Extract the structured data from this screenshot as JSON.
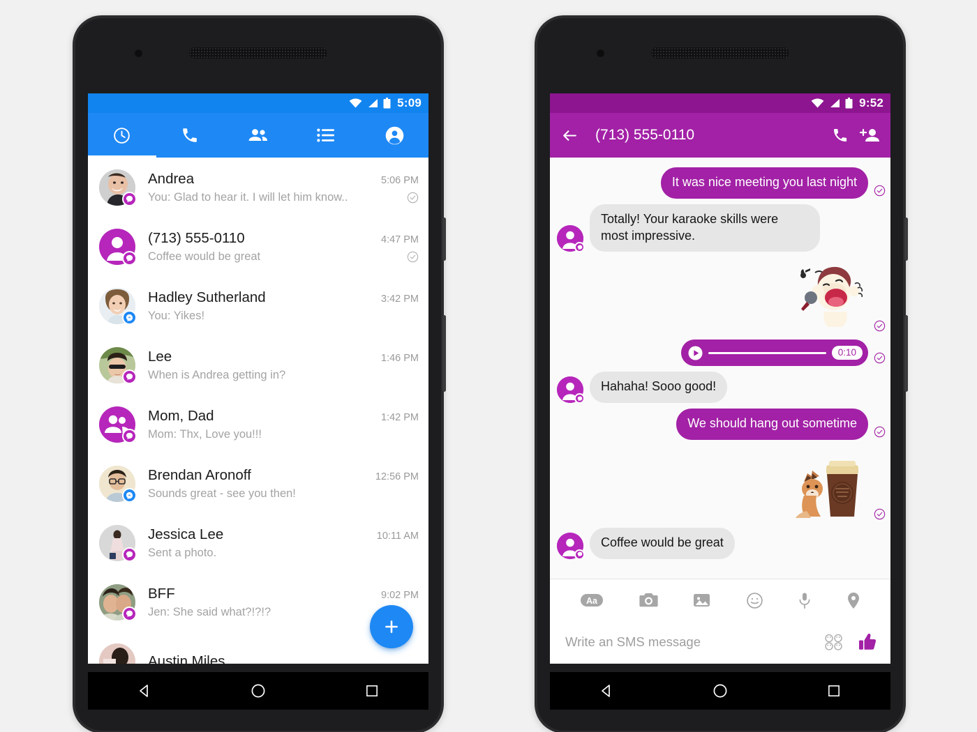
{
  "left_phone": {
    "status_bar": {
      "time": "5:09",
      "wifi_icon": "wifi-icon",
      "signal_icon": "signal-icon",
      "battery_icon": "battery-icon"
    },
    "accent_color": "#1e88f5",
    "tabs": [
      {
        "name": "recents-tab",
        "icon": "clock-icon",
        "active": true
      },
      {
        "name": "calls-tab",
        "icon": "phone-icon",
        "active": false
      },
      {
        "name": "people-tab",
        "icon": "people-icon",
        "active": false
      },
      {
        "name": "groups-tab",
        "icon": "list-icon",
        "active": false
      },
      {
        "name": "profile-tab",
        "icon": "account-icon",
        "active": false
      }
    ],
    "conversations": [
      {
        "name": "Andrea",
        "snippet": "You: Glad to hear it. I will let him know..",
        "time": "5:06 PM",
        "badge": "sms",
        "delivered": true,
        "avatar": "photo-man-laughing"
      },
      {
        "name": "(713) 555-0110",
        "snippet": "Coffee would be great",
        "time": "4:47 PM",
        "badge": "sms",
        "delivered": true,
        "avatar": "placeholder-person"
      },
      {
        "name": "Hadley Sutherland",
        "snippet": "You: Yikes!",
        "time": "3:42 PM",
        "badge": "messenger",
        "delivered": false,
        "avatar": "photo-woman-blonde"
      },
      {
        "name": "Lee",
        "snippet": "When is Andrea getting in?",
        "time": "1:46 PM",
        "badge": "sms",
        "delivered": false,
        "avatar": "photo-woman-sunglasses"
      },
      {
        "name": "Mom, Dad",
        "snippet": "Mom: Thx, Love you!!!",
        "time": "1:42 PM",
        "badge": "sms",
        "delivered": false,
        "avatar": "placeholder-group"
      },
      {
        "name": "Brendan Aronoff",
        "snippet": "Sounds great - see you then!",
        "time": "12:56 PM",
        "badge": "messenger",
        "delivered": false,
        "avatar": "photo-man-glasses"
      },
      {
        "name": "Jessica Lee",
        "snippet": "Sent a photo.",
        "time": "10:11 AM",
        "badge": "sms",
        "delivered": false,
        "avatar": "photo-woman-standing"
      },
      {
        "name": "BFF",
        "snippet": "Jen: She said what?!?!?",
        "time": "9:02 PM",
        "badge": "sms",
        "delivered": false,
        "avatar": "photo-two-women"
      },
      {
        "name": "Austin Miles",
        "snippet": "",
        "time": "",
        "badge": "sms",
        "delivered": false,
        "avatar": "photo-person-partial"
      }
    ],
    "fab": {
      "label": "+",
      "name": "new-conversation-fab"
    },
    "nav_bar": {
      "back": "back-icon",
      "home": "home-icon",
      "recents": "recents-icon"
    }
  },
  "right_phone": {
    "status_bar": {
      "time": "9:52",
      "wifi_icon": "wifi-icon",
      "signal_icon": "signal-icon",
      "battery_icon": "battery-icon"
    },
    "accent_color": "#a221a6",
    "header": {
      "back_icon": "arrow-back-icon",
      "title": "(713) 555-0110",
      "call_icon": "phone-icon",
      "add_person_icon": "person-add-icon"
    },
    "messages": [
      {
        "type": "text",
        "direction": "out",
        "text": "It was nice meeting you last night",
        "delivered": true
      },
      {
        "type": "text",
        "direction": "in",
        "text": "Totally! Your karaoke skills were most impressive.",
        "delivered": false
      },
      {
        "type": "sticker",
        "direction": "out",
        "sticker": "karaoke-singer-sticker",
        "delivered": true
      },
      {
        "type": "audio",
        "direction": "out",
        "duration": "0:10",
        "play_icon": "play-icon",
        "delivered": true
      },
      {
        "type": "text",
        "direction": "in",
        "text": "Hahaha! Sooo good!",
        "delivered": false
      },
      {
        "type": "text",
        "direction": "out",
        "text": "We should hang out sometime",
        "delivered": true
      },
      {
        "type": "sticker",
        "direction": "out",
        "sticker": "fox-coffee-cup-sticker",
        "delivered": true
      },
      {
        "type": "text",
        "direction": "in",
        "text": "Coffee would be great",
        "delivered": false
      }
    ],
    "composer": {
      "icons": [
        {
          "name": "text-format-button",
          "icon": "aa-icon"
        },
        {
          "name": "camera-button",
          "icon": "camera-icon"
        },
        {
          "name": "gallery-button",
          "icon": "image-icon"
        },
        {
          "name": "emoji-button",
          "icon": "smiley-icon"
        },
        {
          "name": "voice-button",
          "icon": "microphone-icon"
        },
        {
          "name": "location-button",
          "icon": "location-pin-icon"
        }
      ],
      "placeholder": "Write an SMS message",
      "stickers_icon": "stickers-icon",
      "like_icon": "thumbs-up-icon"
    },
    "nav_bar": {
      "back": "back-icon",
      "home": "home-icon",
      "recents": "recents-icon"
    }
  }
}
